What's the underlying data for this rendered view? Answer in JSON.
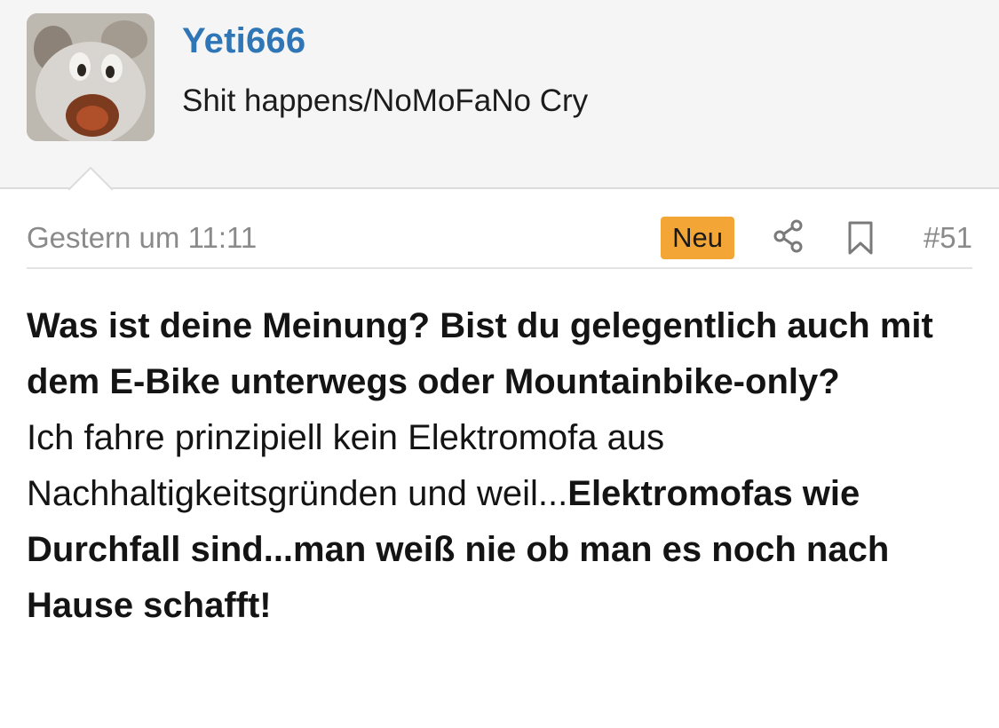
{
  "user": {
    "name": "Yeti666",
    "title": "Shit happens/NoMoFaNo Cry"
  },
  "post": {
    "date": "Gestern um 11:11",
    "badge": "Neu",
    "number": "#51",
    "question": "Was ist deine Meinung? Bist du gelegentlich auch mit dem E-Bike unterwegs oder Mountainbike-only?",
    "text_normal": "Ich fahre prinzipiell kein Elektromofa aus Nachhaltigkeitsgründen und weil...",
    "text_bold": "Elektromofas wie Durchfall sind...man weiß nie ob man es noch nach Hause schafft!"
  },
  "icons": {
    "share": "share-icon",
    "bookmark": "bookmark-icon"
  },
  "colors": {
    "username": "#2f76b7",
    "badge": "#f3a536",
    "meta_text": "#8a8a8a"
  }
}
